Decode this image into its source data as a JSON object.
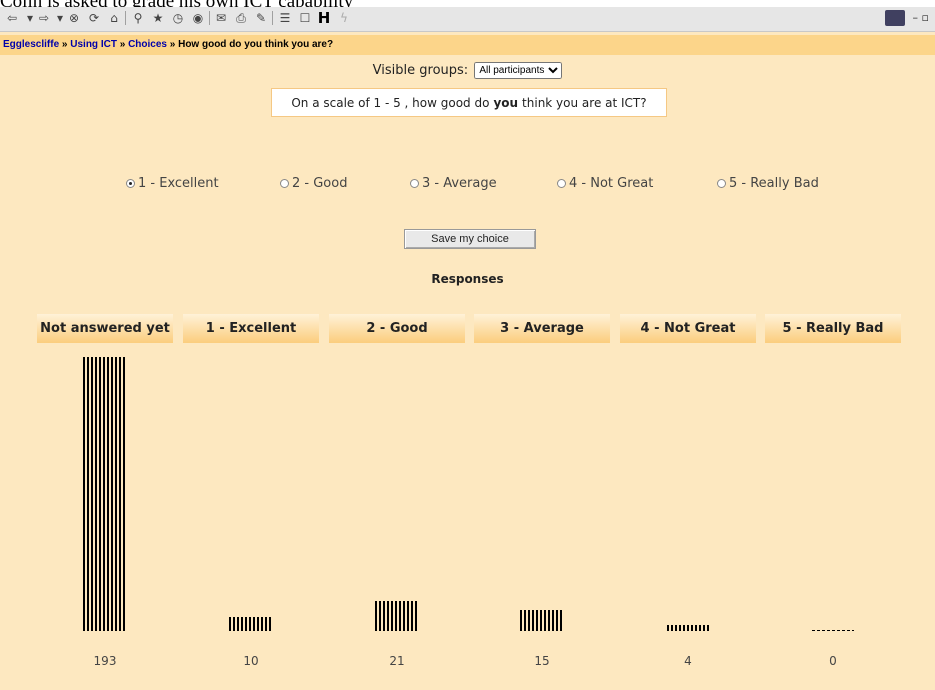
{
  "caption": "Colin is asked to grade his own ICT capability",
  "breadcrumb": {
    "items": [
      "Egglescliffe",
      "Using ICT",
      "Choices"
    ],
    "separator": " » ",
    "current": "How good do you think you are?"
  },
  "groups": {
    "label": "Visible groups:",
    "selected": "All participants"
  },
  "question": {
    "before": "On a scale of 1 - 5 , how good do",
    "bold": "you",
    "after": "think you are at ICT?"
  },
  "options": [
    {
      "label": "1 - Excellent",
      "checked": true
    },
    {
      "label": "2 - Good",
      "checked": false
    },
    {
      "label": "3 - Average",
      "checked": false
    },
    {
      "label": "4 - Not Great",
      "checked": false
    },
    {
      "label": "5 - Really Bad",
      "checked": false
    }
  ],
  "save_label": "Save my choice",
  "responses_title": "Responses",
  "chart_data": {
    "type": "bar",
    "categories": [
      "Not answered yet",
      "1 - Excellent",
      "2 - Good",
      "3 - Average",
      "4 - Not Great",
      "5 - Really Bad"
    ],
    "values": [
      193,
      10,
      21,
      15,
      4,
      0
    ],
    "title": "Responses",
    "xlabel": "",
    "ylabel": "",
    "grid": false
  },
  "colors": {
    "page": "#fde8c0",
    "navbar": "#fcd58a",
    "header_gradient_end": "#fbcd7d",
    "link": "#0000aa"
  },
  "toolbar_icons": [
    "back-icon",
    "forward-icon",
    "stop-icon",
    "refresh-icon",
    "home-icon",
    "search-icon",
    "favorites-icon",
    "history-icon",
    "mail-icon",
    "print-icon",
    "edit-icon",
    "discuss-icon",
    "messenger-icon",
    "bold-h-icon",
    "lightning-icon"
  ]
}
